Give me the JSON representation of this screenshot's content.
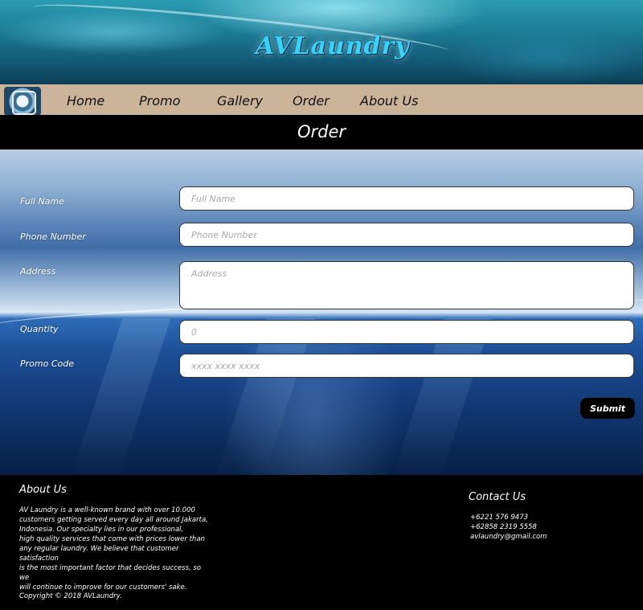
{
  "header": {
    "logo_text": "AVLaundry"
  },
  "nav": {
    "logo_icon": "washing-machine-icon",
    "items": [
      {
        "label": "Home"
      },
      {
        "label": "Promo"
      },
      {
        "label": "Gallery"
      },
      {
        "label": "Order"
      },
      {
        "label": "About Us"
      }
    ]
  },
  "page": {
    "title": "Order"
  },
  "form": {
    "full_name": {
      "label": "Full Name",
      "placeholder": "Full Name",
      "value": ""
    },
    "phone": {
      "label": "Phone Number",
      "placeholder": "Phone Number",
      "value": ""
    },
    "address": {
      "label": "Address",
      "placeholder": "Address",
      "value": ""
    },
    "quantity": {
      "label": "Quantity",
      "placeholder": "0",
      "value": ""
    },
    "promo": {
      "label": "Promo Code",
      "placeholder": "xxxx xxxx xxxx",
      "value": ""
    },
    "submit_label": "Submit"
  },
  "footer": {
    "about_heading": "About Us",
    "about_lines": [
      "AV Laundry is a well-known brand with over 10.000",
      "customers getting served every day all around Jakarta,",
      "Indonesia. Our specialty lies in our professional,",
      "high quality services that come with prices lower than",
      "any regular laundry. We believe that customer satisfaction",
      "is the most important factor that decides success, so we",
      "will continue to improve for our customers' sake."
    ],
    "contact_heading": "Contact Us",
    "contacts": [
      "+6221 576 9473",
      "+62858 2319 5558",
      "avlaundry@gmail.com"
    ],
    "copyright": "Copyright © 2018 AVLaundry."
  }
}
